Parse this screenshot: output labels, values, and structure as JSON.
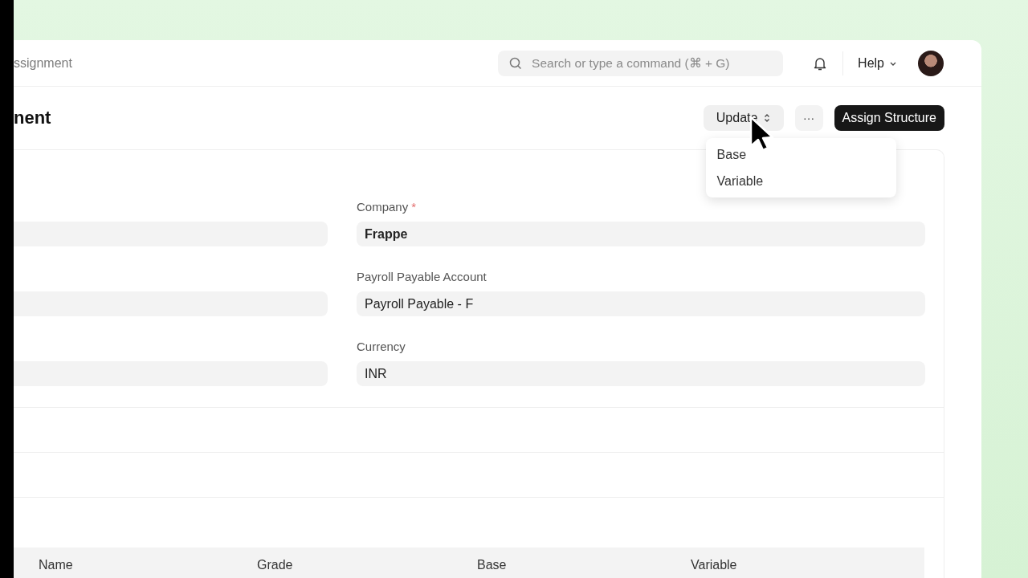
{
  "breadcrumb": "ssignment",
  "search": {
    "placeholder": "Search or type a command (⌘ + G)"
  },
  "help": "Help",
  "page_title": "nent",
  "actions": {
    "update": "Update",
    "more": "···",
    "primary": "Assign Structure"
  },
  "dropdown": {
    "open": true,
    "items": [
      {
        "label": "Base"
      },
      {
        "label": "Variable"
      }
    ]
  },
  "fields": [
    {
      "label": "Company",
      "required_mark": "*",
      "value": "Frappe",
      "bold": true
    },
    {
      "label": "Payroll Payable Account",
      "value": "Payroll Payable - F",
      "bold": false
    },
    {
      "label": "Currency",
      "value": "INR",
      "bold": false
    }
  ],
  "table": {
    "columns": [
      "Name",
      "Grade",
      "Base",
      "Variable"
    ]
  }
}
